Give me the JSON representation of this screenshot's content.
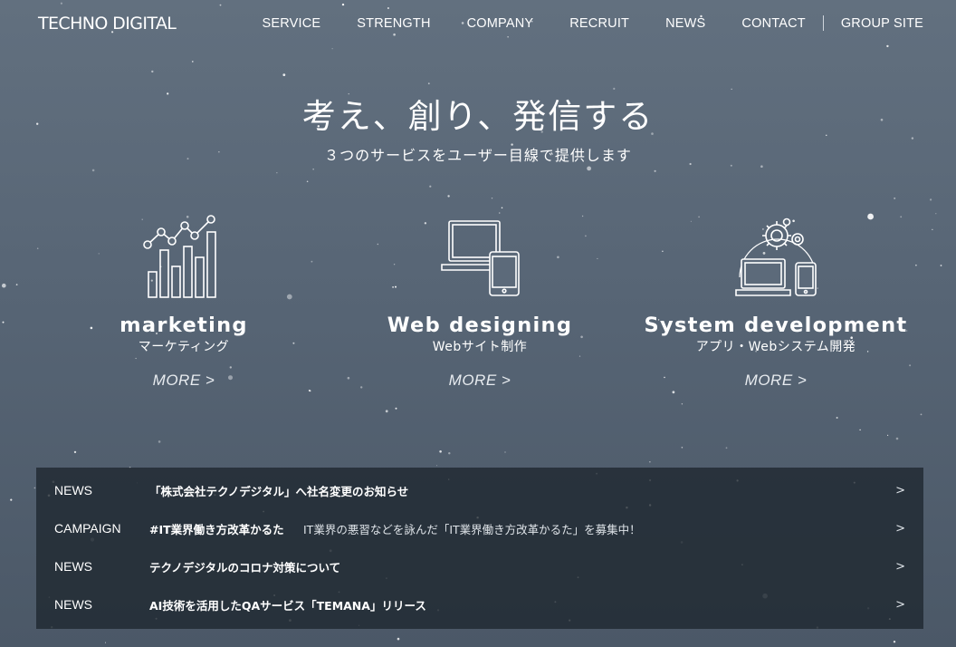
{
  "header": {
    "logo": "TECHNO DIGITAL",
    "nav": [
      "SERVICE",
      "STRENGTH",
      "COMPANY",
      "RECRUIT",
      "NEWS",
      "CONTACT"
    ],
    "group_site": "GROUP SITE"
  },
  "hero": {
    "title": "考え、創り、発信する",
    "subtitle": "３つのサービスをユーザー目線で提供します"
  },
  "services": [
    {
      "icon": "bar-chart-icon",
      "title": "marketing",
      "subtitle": "マーケティング",
      "more": "MORE >"
    },
    {
      "icon": "devices-icon",
      "title": "Web designing",
      "subtitle": "Webサイト制作",
      "more": "MORE >"
    },
    {
      "icon": "gear-devices-icon",
      "title": "System development",
      "subtitle": "アプリ・Webシステム開発",
      "more": "MORE >"
    }
  ],
  "news": [
    {
      "category": "NEWS",
      "title": "「株式会社テクノデジタル」へ社名変更のお知らせ",
      "desc": "",
      "arrow": ">"
    },
    {
      "category": "CAMPAIGN",
      "title": "#IT業界働き方改革かるた",
      "desc": "IT業界の悪習などを詠んだ「IT業界働き方改革かるた」を募集中！",
      "arrow": ">"
    },
    {
      "category": "NEWS",
      "title": "テクノデジタルのコロナ対策について",
      "desc": "",
      "arrow": ">"
    },
    {
      "category": "NEWS",
      "title": "AI技術を活用したQAサービス「TEMANA」リリース",
      "desc": "",
      "arrow": ">"
    }
  ],
  "colors": {
    "background": "#5c6a7a",
    "news_panel": "#1e262e",
    "text": "#ffffff"
  }
}
